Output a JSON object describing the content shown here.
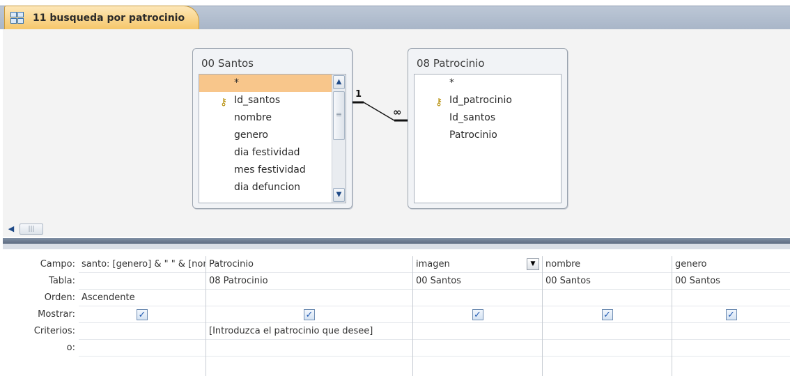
{
  "tab": {
    "title": "11 busqueda por patrocinio",
    "icon": "query-icon"
  },
  "tables": [
    {
      "title": "00 Santos",
      "fields": [
        {
          "label": "*",
          "key": false,
          "selected": true
        },
        {
          "label": "Id_santos",
          "key": true,
          "selected": false
        },
        {
          "label": "nombre",
          "key": false,
          "selected": false
        },
        {
          "label": "genero",
          "key": false,
          "selected": false
        },
        {
          "label": "dia festividad",
          "key": false,
          "selected": false
        },
        {
          "label": "mes festividad",
          "key": false,
          "selected": false
        },
        {
          "label": "dia defuncion",
          "key": false,
          "selected": false
        }
      ]
    },
    {
      "title": "08 Patrocinio",
      "fields": [
        {
          "label": "*",
          "key": false,
          "selected": false
        },
        {
          "label": "Id_patrocinio",
          "key": true,
          "selected": false
        },
        {
          "label": "Id_santos",
          "key": false,
          "selected": false
        },
        {
          "label": "Patrocinio",
          "key": false,
          "selected": false
        }
      ]
    }
  ],
  "relationship": {
    "one_label": "1",
    "many_label": "∞"
  },
  "grid": {
    "row_labels": {
      "field": "Campo:",
      "table": "Tabla:",
      "sort": "Orden:",
      "show": "Mostrar:",
      "criteria": "Criterios:",
      "or": "o:"
    },
    "columns": [
      {
        "field": "santo: [genero] & \" \" & [nombre]",
        "table": "",
        "sort": "Ascendente",
        "show": true,
        "criteria": "",
        "or": ""
      },
      {
        "field": "Patrocinio",
        "table": "08 Patrocinio",
        "sort": "",
        "show": true,
        "criteria": "[Introduzca el patrocinio que desee]",
        "or": ""
      },
      {
        "field": "imagen",
        "table": "00 Santos",
        "sort": "",
        "show": true,
        "criteria": "",
        "or": ""
      },
      {
        "field": "nombre",
        "table": "00 Santos",
        "sort": "",
        "show": true,
        "criteria": "",
        "or": ""
      },
      {
        "field": "genero",
        "table": "00 Santos",
        "sort": "",
        "show": true,
        "criteria": "",
        "or": ""
      }
    ]
  },
  "check_glyph": "✓",
  "icons": {
    "scroll_left": "◀",
    "scroll_right": "▶",
    "scroll_up": "▲",
    "scroll_down": "▼",
    "dropdown": "▼",
    "key": "key-icon"
  }
}
